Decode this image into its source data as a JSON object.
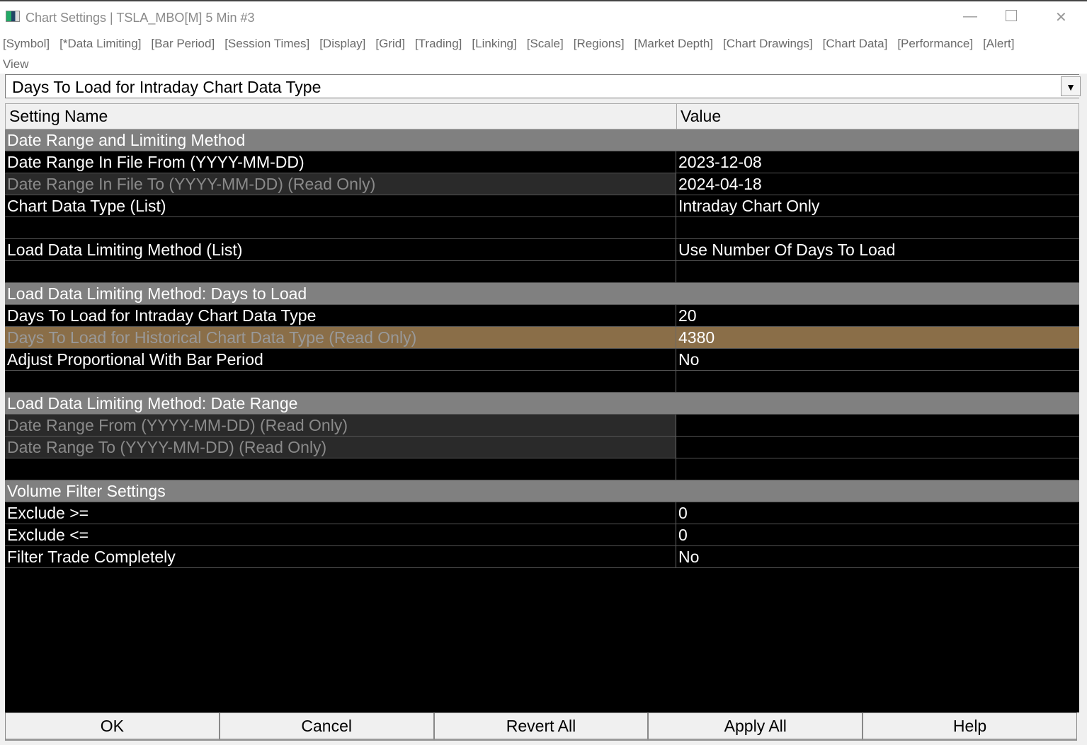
{
  "window": {
    "title": "Chart Settings | TSLA_MBO[M]  5 Min  #3"
  },
  "menu": [
    "[Symbol]",
    "[*Data Limiting]",
    "[Bar Period]",
    "[Session Times]",
    "[Display]",
    "[Grid]",
    "[Trading]",
    "[Linking]",
    "[Scale]",
    "[Regions]",
    "[Market Depth]",
    "[Chart Drawings]",
    "[Chart Data]",
    "[Performance]",
    "[Alert]"
  ],
  "view_label": "View",
  "view_selected": "Days To Load for Intraday Chart Data Type",
  "table": {
    "headers": [
      "Setting Name",
      "Value"
    ],
    "rows": [
      {
        "t": "sec",
        "name": "Date Range and Limiting Method",
        "value": ""
      },
      {
        "t": "norm",
        "name": "Date Range In File From (YYYY-MM-DD)",
        "value": "2023-12-08"
      },
      {
        "t": "ro",
        "name": "Date Range In File To (YYYY-MM-DD) (Read Only)",
        "value": "2024-04-18"
      },
      {
        "t": "norm",
        "name": "Chart Data Type (List)",
        "value": "Intraday Chart Only"
      },
      {
        "t": "norm",
        "name": "",
        "value": ""
      },
      {
        "t": "norm",
        "name": "Load Data Limiting Method (List)",
        "value": "Use Number Of Days To Load"
      },
      {
        "t": "norm",
        "name": "",
        "value": ""
      },
      {
        "t": "sec",
        "name": "Load Data Limiting Method: Days to Load",
        "value": ""
      },
      {
        "t": "norm",
        "name": "Days To Load for Intraday Chart Data Type",
        "value": "20"
      },
      {
        "t": "sel",
        "name": "Days To Load for Historical Chart Data Type (Read Only)",
        "value": "4380"
      },
      {
        "t": "norm",
        "name": "Adjust Proportional With Bar Period",
        "value": "No"
      },
      {
        "t": "norm",
        "name": "",
        "value": ""
      },
      {
        "t": "sec",
        "name": "Load Data Limiting Method: Date Range",
        "value": ""
      },
      {
        "t": "ro",
        "name": "Date Range From (YYYY-MM-DD) (Read Only)",
        "value": ""
      },
      {
        "t": "ro",
        "name": "Date Range To (YYYY-MM-DD) (Read Only)",
        "value": ""
      },
      {
        "t": "norm",
        "name": "",
        "value": ""
      },
      {
        "t": "sec",
        "name": "Volume Filter Settings",
        "value": ""
      },
      {
        "t": "norm",
        "name": "Exclude >=",
        "value": "0"
      },
      {
        "t": "norm",
        "name": "Exclude <=",
        "value": "0"
      },
      {
        "t": "norm",
        "name": "Filter Trade Completely",
        "value": "No"
      }
    ]
  },
  "buttons": [
    "OK",
    "Cancel",
    "Revert All",
    "Apply All",
    "Help"
  ]
}
